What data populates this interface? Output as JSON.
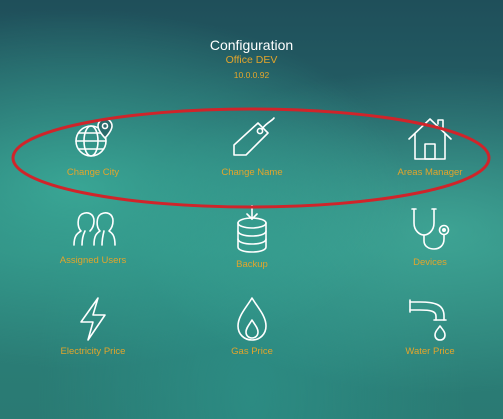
{
  "header": {
    "title": "Configuration",
    "subtitle": "Office DEV",
    "ip": "10.0.0.92"
  },
  "tiles": [
    {
      "label": "Change City",
      "icon": "globe-pin-icon"
    },
    {
      "label": "Change Name",
      "icon": "tag-icon"
    },
    {
      "label": "Areas Manager",
      "icon": "house-icon"
    },
    {
      "label": "Assigned Users",
      "icon": "users-icon"
    },
    {
      "label": "Backup",
      "icon": "database-download-icon"
    },
    {
      "label": "Devices",
      "icon": "stethoscope-icon"
    },
    {
      "label": "Electricity Price",
      "icon": "lightning-icon"
    },
    {
      "label": "Gas Price",
      "icon": "flame-icon"
    },
    {
      "label": "Water Price",
      "icon": "faucet-icon"
    }
  ],
  "colors": {
    "accent": "#e3a52b",
    "highlight_ellipse": "#d0242a",
    "icon_stroke": "#ffffff"
  }
}
